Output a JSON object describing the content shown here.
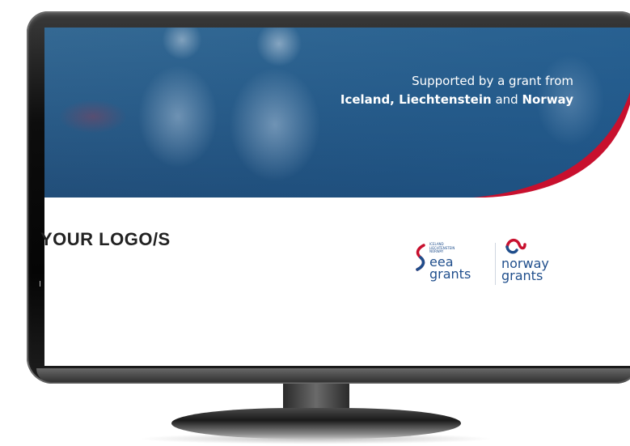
{
  "banner": {
    "line1": "Supported by a grant from",
    "line2_part1": "Iceland, Liechtenstein",
    "line2_and1": " and ",
    "line2_part2": "Norway"
  },
  "logo_placeholder": "YOUR LOGO/S",
  "eea_logo": {
    "small_lines": [
      "ICELAND",
      "LIECHTENSTEIN",
      "NORWAY"
    ],
    "word1": "eea",
    "word2": "grants"
  },
  "norway_logo": {
    "word1": "norway",
    "word2": "grants"
  },
  "colors": {
    "brand_blue": "#1f4e8c",
    "brand_red": "#c8102e"
  }
}
